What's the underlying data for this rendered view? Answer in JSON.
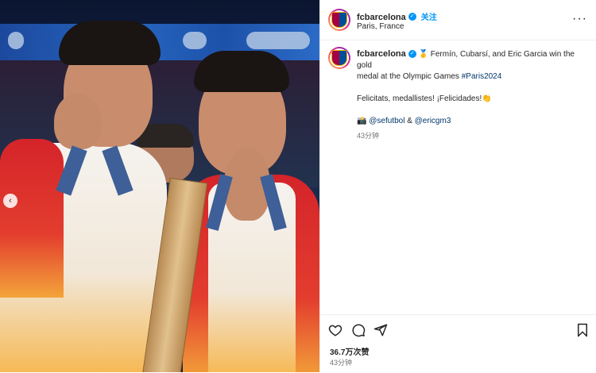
{
  "post": {
    "username": "fcbarcelona",
    "follow_label": "关注",
    "location": "Paris, France",
    "caption_username": "fcbarcelona",
    "caption_line1": "🥇 Fermín, Cubarsí, and Eric Garcia win the gold",
    "caption_line2": "medal at the Olympic Games ",
    "hashtag": "#Paris2024",
    "caption_line3": "Felicitats, medallistes! ¡Felicidades!👏",
    "camera_glyph": "📸",
    "mention1": "@sefutbol",
    "amp": " & ",
    "mention2": "@ericgm3",
    "caption_time": "43分钟",
    "likes": "36.7万次赞",
    "posted_time": "43分钟"
  },
  "icons": {
    "heart": "heart-icon",
    "comment": "comment-icon",
    "share": "share-icon",
    "save": "bookmark-icon",
    "more": "more-options-icon",
    "prev": "chevron-left-icon"
  },
  "colors": {
    "link": "#0095f6",
    "hashtag": "#00376b",
    "muted": "#737373",
    "barca_blue": "#004d98",
    "barca_red": "#a50044"
  }
}
